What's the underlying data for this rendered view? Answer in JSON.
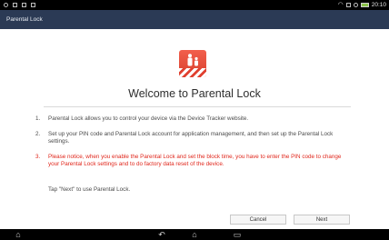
{
  "status_bar": {
    "left_icons": [
      "usb-icon",
      "download-icon",
      "image-icon",
      "sd-card-icon"
    ],
    "right_icons": [
      "wifi-icon",
      "signal-icon",
      "bluetooth-icon",
      "battery-icon"
    ],
    "time": "20:10",
    "battery_color": "#8bc34a"
  },
  "title_bar": {
    "title": "Parental Lock",
    "color": "#2b3a55"
  },
  "hero": {
    "icon": "parental-lock-icon",
    "color": "#f25f4c"
  },
  "welcome": "Welcome to Parental Lock",
  "items": [
    {
      "num": "1.",
      "text": "Parental Lock allows you to control your device via the Device Tracker website."
    },
    {
      "num": "2.",
      "text": "Set up your PIN code and Parental Lock account for application management, and then set up the Parental Lock settings."
    },
    {
      "num": "3.",
      "text": "Please notice, when you enable the Parental Lock and set the block time, you have to enter the PIN code to change your Parental Lock settings and to do factory data reset of the device.",
      "alert": true
    }
  ],
  "tap_text": "Tap \"Next\" to use Parental Lock.",
  "buttons": {
    "cancel": "Cancel",
    "next": "Next"
  },
  "nav_bar": {
    "icons": [
      "back-icon",
      "home-icon",
      "recent-apps-icon",
      "keyboard-hide-icon"
    ]
  }
}
